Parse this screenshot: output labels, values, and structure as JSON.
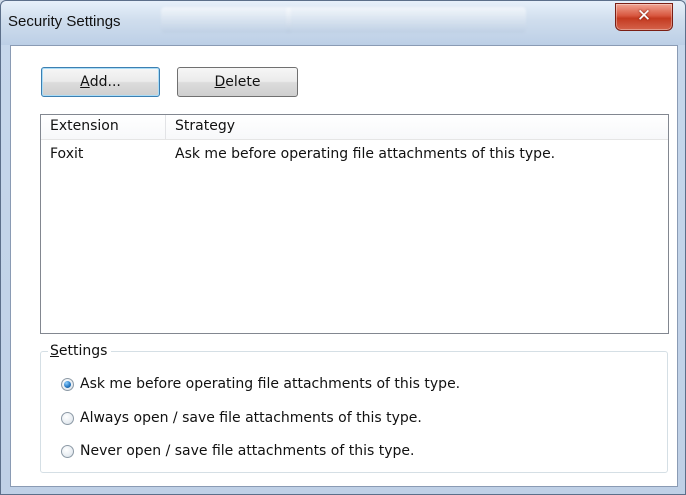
{
  "window": {
    "title": "Security Settings",
    "close_glyph": "✕"
  },
  "toolbar": {
    "add": {
      "accel": "A",
      "rest": "dd..."
    },
    "delete": {
      "accel": "D",
      "rest": "elete"
    }
  },
  "table": {
    "columns": [
      "Extension",
      "Strategy"
    ],
    "rows": [
      {
        "extension": "Foxit",
        "strategy": "Ask me before operating file attachments of this type."
      }
    ]
  },
  "settings": {
    "legend_accel": "S",
    "legend_rest": "ettings",
    "options": [
      {
        "label": "Ask me before operating file attachments of this type.",
        "checked": true
      },
      {
        "label": "Always open / save file attachments of this type.",
        "checked": false
      },
      {
        "label": "Never open / save file attachments of this type.",
        "checked": false
      }
    ]
  },
  "icons": {
    "close": "close-icon",
    "radio": "radio-icon"
  }
}
